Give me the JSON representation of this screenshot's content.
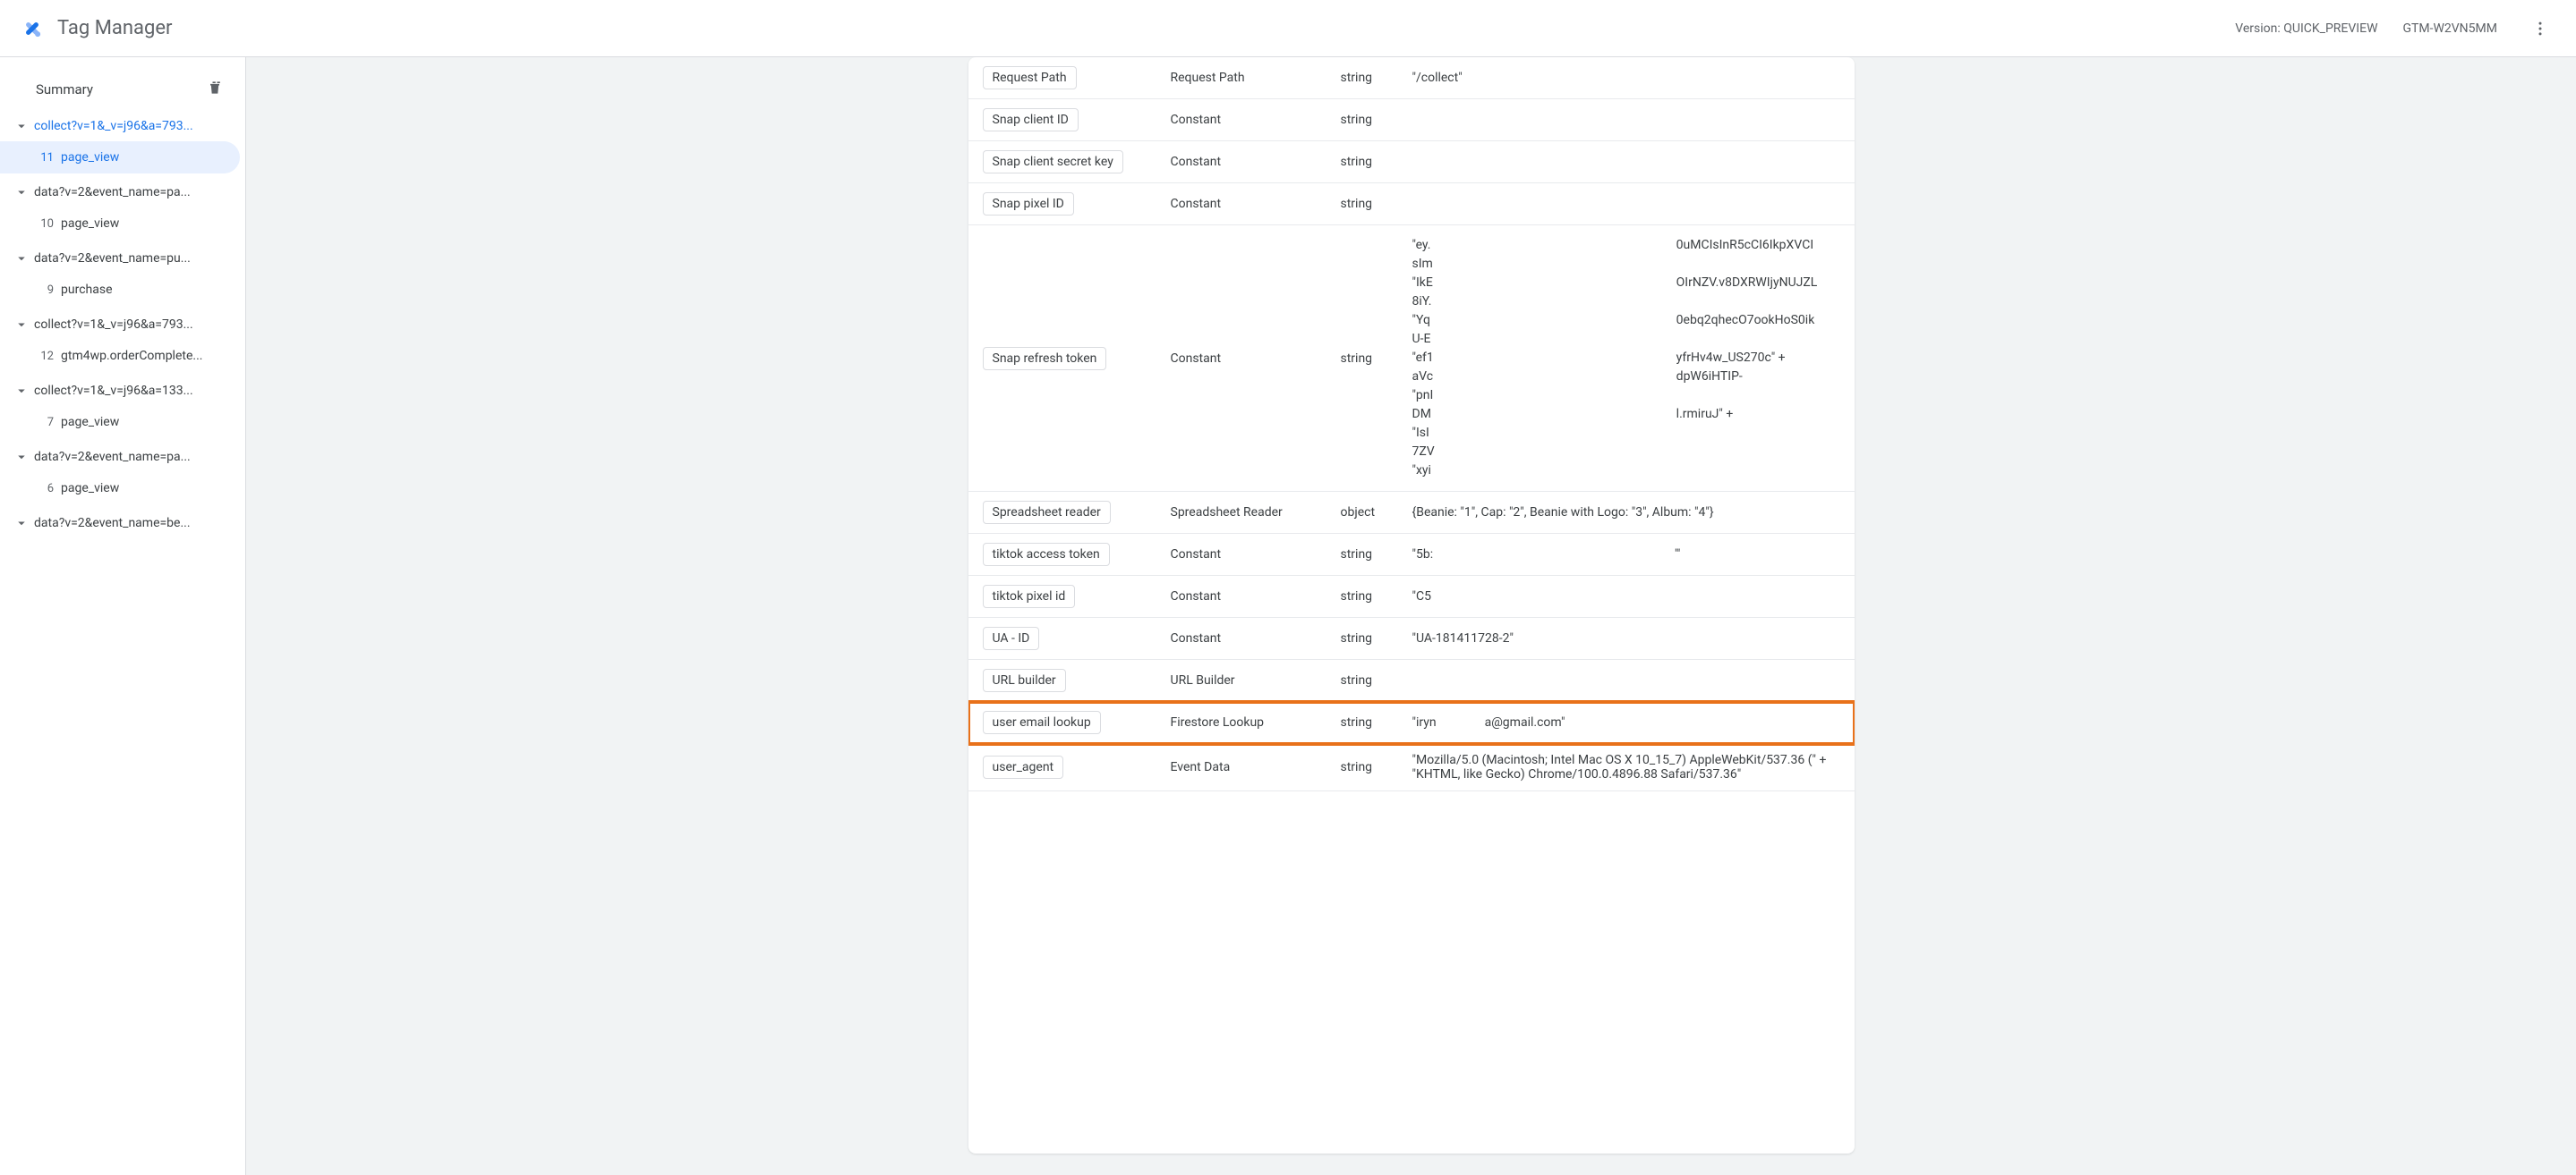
{
  "header": {
    "app_title": "Tag Manager",
    "version_label": "Version: QUICK_PREVIEW",
    "container_id": "GTM-W2VN5MM"
  },
  "sidebar": {
    "summary_label": "Summary",
    "groups": [
      {
        "label": "collect?v=1&_v=j96&a=793...",
        "active_request": true,
        "items": [
          {
            "num": "11",
            "label": "page_view",
            "active": true
          }
        ]
      },
      {
        "label": "data?v=2&event_name=pa...",
        "items": [
          {
            "num": "10",
            "label": "page_view"
          }
        ]
      },
      {
        "label": "data?v=2&event_name=pu...",
        "items": [
          {
            "num": "9",
            "label": "purchase"
          }
        ]
      },
      {
        "label": "collect?v=1&_v=j96&a=793...",
        "items": [
          {
            "num": "12",
            "label": "gtm4wp.orderComplete..."
          }
        ]
      },
      {
        "label": "collect?v=1&_v=j96&a=133...",
        "items": [
          {
            "num": "7",
            "label": "page_view"
          }
        ]
      },
      {
        "label": "data?v=2&event_name=pa...",
        "items": [
          {
            "num": "6",
            "label": "page_view"
          }
        ]
      },
      {
        "label": "data?v=2&event_name=be...",
        "items": []
      }
    ]
  },
  "rows": [
    {
      "name": "Request Path",
      "variable_type": "Request Path",
      "return_type": "string",
      "value": "\"/collect\""
    },
    {
      "name": "Snap client ID",
      "variable_type": "Constant",
      "return_type": "string",
      "value": ""
    },
    {
      "name": "Snap client secret key",
      "variable_type": "Constant",
      "return_type": "string",
      "value": ""
    },
    {
      "name": "Snap pixel ID",
      "variable_type": "Constant",
      "return_type": "string",
      "value": ""
    },
    {
      "name": "Snap refresh token",
      "variable_type": "Constant",
      "return_type": "string",
      "token_left": "\"ey.\nsIm\n\"IkE\n8iY.\n\"Yq\nU-E\n\"ef1\naVc\n\"pnI\nDM\n\"IsI\n7ZV\n\"xyi",
      "token_right": "0uMCIsInR5cCI6IkpXVCI\n\nOIrNZV.v8DXRWIjyNUJZL\n\n0ebq2qhecO7ookHoS0ik\n\nyfrHv4w_US270c\" +\ndpW6iHTIP-\n\nl.rmiruJ\" +"
    },
    {
      "name": "Spreadsheet reader",
      "variable_type": "Spreadsheet Reader",
      "return_type": "object",
      "value": "{Beanie: \"1\", Cap: \"2\", Beanie with Logo: \"3\", Album: \"4\"}"
    },
    {
      "name": "tiktok access token",
      "variable_type": "Constant",
      "return_type": "string",
      "value_left": "\"5b:",
      "value_right": "'\""
    },
    {
      "name": "tiktok pixel id",
      "variable_type": "Constant",
      "return_type": "string",
      "value": "\"C5"
    },
    {
      "name": "UA - ID",
      "variable_type": "Constant",
      "return_type": "string",
      "value": "\"UA-181411728-2\""
    },
    {
      "name": "URL builder",
      "variable_type": "URL Builder",
      "return_type": "string",
      "value": ""
    },
    {
      "name": "user email lookup",
      "variable_type": "Firestore Lookup",
      "return_type": "string",
      "value_left": "\"iryn",
      "value_right": "a@gmail.com\"",
      "highlight": true
    },
    {
      "name": "user_agent",
      "variable_type": "Event Data",
      "return_type": "string",
      "value": "\"Mozilla/5.0 (Macintosh; Intel Mac OS X 10_15_7) AppleWebKit/537.36 (\" + \"KHTML, like Gecko) Chrome/100.0.4896.88 Safari/537.36\""
    }
  ]
}
